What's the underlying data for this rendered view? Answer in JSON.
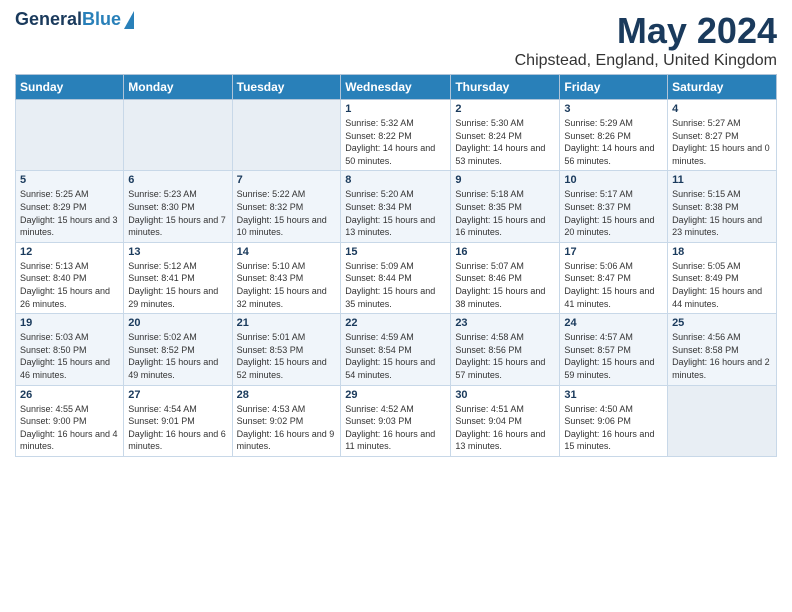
{
  "header": {
    "logo_general": "General",
    "logo_blue": "Blue",
    "main_title": "May 2024",
    "subtitle": "Chipstead, England, United Kingdom"
  },
  "weekdays": [
    "Sunday",
    "Monday",
    "Tuesday",
    "Wednesday",
    "Thursday",
    "Friday",
    "Saturday"
  ],
  "weeks": [
    [
      {
        "day": "",
        "sunrise": "",
        "sunset": "",
        "daylight": ""
      },
      {
        "day": "",
        "sunrise": "",
        "sunset": "",
        "daylight": ""
      },
      {
        "day": "",
        "sunrise": "",
        "sunset": "",
        "daylight": ""
      },
      {
        "day": "1",
        "sunrise": "Sunrise: 5:32 AM",
        "sunset": "Sunset: 8:22 PM",
        "daylight": "Daylight: 14 hours and 50 minutes."
      },
      {
        "day": "2",
        "sunrise": "Sunrise: 5:30 AM",
        "sunset": "Sunset: 8:24 PM",
        "daylight": "Daylight: 14 hours and 53 minutes."
      },
      {
        "day": "3",
        "sunrise": "Sunrise: 5:29 AM",
        "sunset": "Sunset: 8:26 PM",
        "daylight": "Daylight: 14 hours and 56 minutes."
      },
      {
        "day": "4",
        "sunrise": "Sunrise: 5:27 AM",
        "sunset": "Sunset: 8:27 PM",
        "daylight": "Daylight: 15 hours and 0 minutes."
      }
    ],
    [
      {
        "day": "5",
        "sunrise": "Sunrise: 5:25 AM",
        "sunset": "Sunset: 8:29 PM",
        "daylight": "Daylight: 15 hours and 3 minutes."
      },
      {
        "day": "6",
        "sunrise": "Sunrise: 5:23 AM",
        "sunset": "Sunset: 8:30 PM",
        "daylight": "Daylight: 15 hours and 7 minutes."
      },
      {
        "day": "7",
        "sunrise": "Sunrise: 5:22 AM",
        "sunset": "Sunset: 8:32 PM",
        "daylight": "Daylight: 15 hours and 10 minutes."
      },
      {
        "day": "8",
        "sunrise": "Sunrise: 5:20 AM",
        "sunset": "Sunset: 8:34 PM",
        "daylight": "Daylight: 15 hours and 13 minutes."
      },
      {
        "day": "9",
        "sunrise": "Sunrise: 5:18 AM",
        "sunset": "Sunset: 8:35 PM",
        "daylight": "Daylight: 15 hours and 16 minutes."
      },
      {
        "day": "10",
        "sunrise": "Sunrise: 5:17 AM",
        "sunset": "Sunset: 8:37 PM",
        "daylight": "Daylight: 15 hours and 20 minutes."
      },
      {
        "day": "11",
        "sunrise": "Sunrise: 5:15 AM",
        "sunset": "Sunset: 8:38 PM",
        "daylight": "Daylight: 15 hours and 23 minutes."
      }
    ],
    [
      {
        "day": "12",
        "sunrise": "Sunrise: 5:13 AM",
        "sunset": "Sunset: 8:40 PM",
        "daylight": "Daylight: 15 hours and 26 minutes."
      },
      {
        "day": "13",
        "sunrise": "Sunrise: 5:12 AM",
        "sunset": "Sunset: 8:41 PM",
        "daylight": "Daylight: 15 hours and 29 minutes."
      },
      {
        "day": "14",
        "sunrise": "Sunrise: 5:10 AM",
        "sunset": "Sunset: 8:43 PM",
        "daylight": "Daylight: 15 hours and 32 minutes."
      },
      {
        "day": "15",
        "sunrise": "Sunrise: 5:09 AM",
        "sunset": "Sunset: 8:44 PM",
        "daylight": "Daylight: 15 hours and 35 minutes."
      },
      {
        "day": "16",
        "sunrise": "Sunrise: 5:07 AM",
        "sunset": "Sunset: 8:46 PM",
        "daylight": "Daylight: 15 hours and 38 minutes."
      },
      {
        "day": "17",
        "sunrise": "Sunrise: 5:06 AM",
        "sunset": "Sunset: 8:47 PM",
        "daylight": "Daylight: 15 hours and 41 minutes."
      },
      {
        "day": "18",
        "sunrise": "Sunrise: 5:05 AM",
        "sunset": "Sunset: 8:49 PM",
        "daylight": "Daylight: 15 hours and 44 minutes."
      }
    ],
    [
      {
        "day": "19",
        "sunrise": "Sunrise: 5:03 AM",
        "sunset": "Sunset: 8:50 PM",
        "daylight": "Daylight: 15 hours and 46 minutes."
      },
      {
        "day": "20",
        "sunrise": "Sunrise: 5:02 AM",
        "sunset": "Sunset: 8:52 PM",
        "daylight": "Daylight: 15 hours and 49 minutes."
      },
      {
        "day": "21",
        "sunrise": "Sunrise: 5:01 AM",
        "sunset": "Sunset: 8:53 PM",
        "daylight": "Daylight: 15 hours and 52 minutes."
      },
      {
        "day": "22",
        "sunrise": "Sunrise: 4:59 AM",
        "sunset": "Sunset: 8:54 PM",
        "daylight": "Daylight: 15 hours and 54 minutes."
      },
      {
        "day": "23",
        "sunrise": "Sunrise: 4:58 AM",
        "sunset": "Sunset: 8:56 PM",
        "daylight": "Daylight: 15 hours and 57 minutes."
      },
      {
        "day": "24",
        "sunrise": "Sunrise: 4:57 AM",
        "sunset": "Sunset: 8:57 PM",
        "daylight": "Daylight: 15 hours and 59 minutes."
      },
      {
        "day": "25",
        "sunrise": "Sunrise: 4:56 AM",
        "sunset": "Sunset: 8:58 PM",
        "daylight": "Daylight: 16 hours and 2 minutes."
      }
    ],
    [
      {
        "day": "26",
        "sunrise": "Sunrise: 4:55 AM",
        "sunset": "Sunset: 9:00 PM",
        "daylight": "Daylight: 16 hours and 4 minutes."
      },
      {
        "day": "27",
        "sunrise": "Sunrise: 4:54 AM",
        "sunset": "Sunset: 9:01 PM",
        "daylight": "Daylight: 16 hours and 6 minutes."
      },
      {
        "day": "28",
        "sunrise": "Sunrise: 4:53 AM",
        "sunset": "Sunset: 9:02 PM",
        "daylight": "Daylight: 16 hours and 9 minutes."
      },
      {
        "day": "29",
        "sunrise": "Sunrise: 4:52 AM",
        "sunset": "Sunset: 9:03 PM",
        "daylight": "Daylight: 16 hours and 11 minutes."
      },
      {
        "day": "30",
        "sunrise": "Sunrise: 4:51 AM",
        "sunset": "Sunset: 9:04 PM",
        "daylight": "Daylight: 16 hours and 13 minutes."
      },
      {
        "day": "31",
        "sunrise": "Sunrise: 4:50 AM",
        "sunset": "Sunset: 9:06 PM",
        "daylight": "Daylight: 16 hours and 15 minutes."
      },
      {
        "day": "",
        "sunrise": "",
        "sunset": "",
        "daylight": ""
      }
    ]
  ]
}
